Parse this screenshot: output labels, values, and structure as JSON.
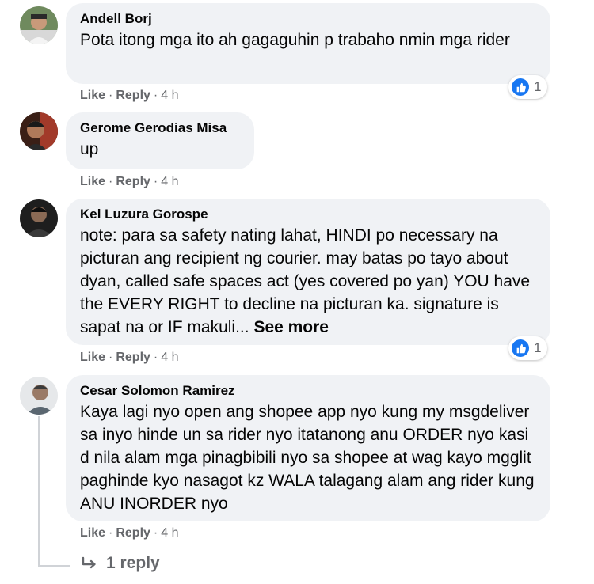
{
  "comments": [
    {
      "name": "Andell Borj",
      "text": "Pota itong mga ito ah gagaguhin p trabaho nmin mga rider",
      "like": "Like",
      "reply": "Reply",
      "time": "4 h",
      "reactions": "1",
      "avatar_color": "#7a8a6c"
    },
    {
      "name": "Gerome Gerodias Misa",
      "text": "up",
      "like": "Like",
      "reply": "Reply",
      "time": "4 h",
      "avatar_color": "#6b3b2a"
    },
    {
      "name": "Kel Luzura Gorospe",
      "text": "note: para sa safety nating lahat, HINDI po necessary na picturan ang recipient ng courier. may batas po tayo about dyan, called safe spaces act (yes covered po yan) YOU have the EVERY RIGHT to decline na picturan ka. signature is sapat na or IF makuli...",
      "see_more": "See more",
      "like": "Like",
      "reply": "Reply",
      "time": "4 h",
      "reactions": "1",
      "avatar_color": "#2b2b2b"
    },
    {
      "name": "Cesar Solomon Ramirez",
      "text": "Kaya lagi nyo open ang shopee app nyo kung my msgdeliver sa inyo hinde un sa rider nyo itatanong anu ORDER nyo kasi d nila alam mga pinagbibili nyo sa shopee at wag kayo mgglit paghinde kyo nasagot kz WALA talagang alam ang rider kung ANU INORDER nyo",
      "like": "Like",
      "reply": "Reply",
      "time": "4 h",
      "avatar_color": "#9aa3a8"
    }
  ],
  "replies_link": "1 reply",
  "colors": {
    "bubble": "#f0f2f5",
    "secondary_text": "#65676b",
    "like_blue": "#1877f2"
  }
}
